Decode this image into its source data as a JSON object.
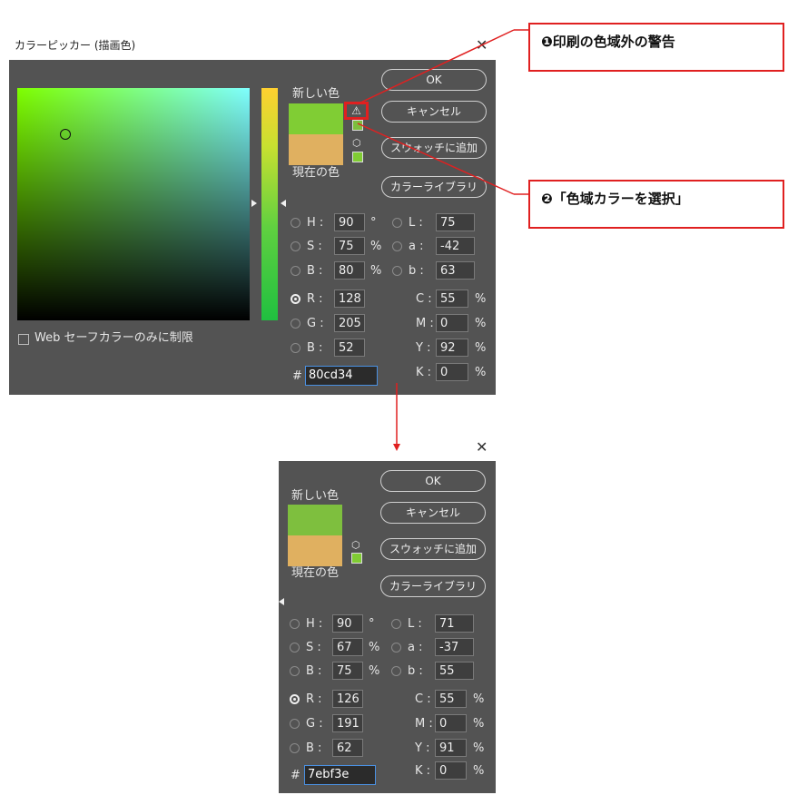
{
  "top_dialog": {
    "window_title": "カラーピッカー (描画色)",
    "new_label": "新しい色",
    "current_label": "現在の色",
    "new_color": "#80cd34",
    "current_color": "#e0b060",
    "gamut_swatch": "#7ebf3e",
    "web_swatch": "#80cc33",
    "buttons": {
      "ok": "OK",
      "cancel": "キャンセル",
      "add_swatch": "スウォッチに追加",
      "libraries": "カラーライブラリ"
    },
    "web_safe_label": "Web セーフカラーのみに制限",
    "hsb": [
      {
        "label": "H :",
        "value": "90",
        "unit": "°"
      },
      {
        "label": "S :",
        "value": "75",
        "unit": "%"
      },
      {
        "label": "B :",
        "value": "80",
        "unit": "%"
      }
    ],
    "lab": [
      {
        "label": "L :",
        "value": "75"
      },
      {
        "label": "a :",
        "value": "-42"
      },
      {
        "label": "b :",
        "value": "63"
      }
    ],
    "rgb": [
      {
        "label": "R :",
        "value": "128"
      },
      {
        "label": "G :",
        "value": "205"
      },
      {
        "label": "B :",
        "value": "52"
      }
    ],
    "cmyk": [
      {
        "label": "C :",
        "value": "55",
        "unit": "%"
      },
      {
        "label": "M :",
        "value": "0",
        "unit": "%"
      },
      {
        "label": "Y :",
        "value": "92",
        "unit": "%"
      },
      {
        "label": "K :",
        "value": "0",
        "unit": "%"
      }
    ],
    "hash": "#",
    "hex": "80cd34"
  },
  "bottom_dialog": {
    "new_label": "新しい色",
    "current_label": "現在の色",
    "new_color": "#7ebf3e",
    "current_color": "#e0b060",
    "web_swatch": "#80cc33",
    "buttons": {
      "ok": "OK",
      "cancel": "キャンセル",
      "add_swatch": "スウォッチに追加",
      "libraries": "カラーライブラリ"
    },
    "hsb": [
      {
        "label": "H :",
        "value": "90",
        "unit": "°"
      },
      {
        "label": "S :",
        "value": "67",
        "unit": "%"
      },
      {
        "label": "B :",
        "value": "75",
        "unit": "%"
      }
    ],
    "lab": [
      {
        "label": "L :",
        "value": "71"
      },
      {
        "label": "a :",
        "value": "-37"
      },
      {
        "label": "b :",
        "value": "55"
      }
    ],
    "rgb": [
      {
        "label": "R :",
        "value": "126"
      },
      {
        "label": "G :",
        "value": "191"
      },
      {
        "label": "B :",
        "value": "62"
      }
    ],
    "cmyk": [
      {
        "label": "C :",
        "value": "55",
        "unit": "%"
      },
      {
        "label": "M :",
        "value": "0",
        "unit": "%"
      },
      {
        "label": "Y :",
        "value": "91",
        "unit": "%"
      },
      {
        "label": "K :",
        "value": "0",
        "unit": "%"
      }
    ],
    "hash": "#",
    "hex": "7ebf3e"
  },
  "callouts": {
    "first": "❶印刷の色域外の警告",
    "second": "❷「色域カラーを選択」"
  },
  "colors": {
    "dialog_bg": "#535353",
    "accent_red": "#e02020",
    "hex_focus": "#4a90e2"
  }
}
